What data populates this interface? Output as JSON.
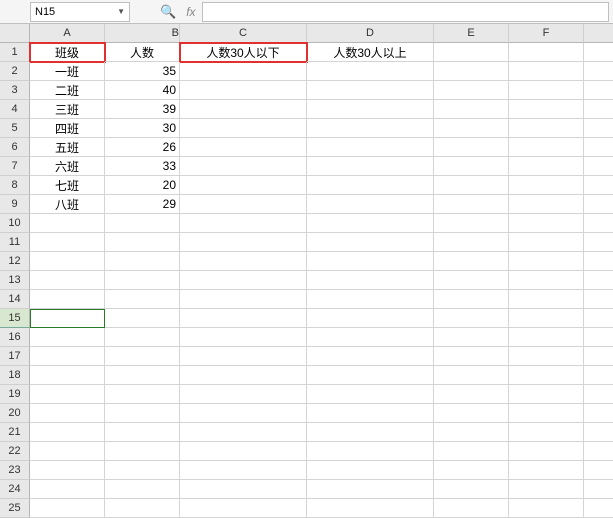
{
  "namebox": {
    "value": "N15"
  },
  "fx": {
    "label": "fx"
  },
  "columns": [
    "A",
    "B",
    "C",
    "D",
    "E",
    "F"
  ],
  "highlighted_headers": [
    "A",
    "C"
  ],
  "active_row": 15,
  "row_count": 25,
  "headers": {
    "A": "班级",
    "B": "人数",
    "C": "人数30人以下",
    "D": "人数30人以上"
  },
  "rows": [
    {
      "A": "一班",
      "B": "35"
    },
    {
      "A": "二班",
      "B": "40"
    },
    {
      "A": "三班",
      "B": "39"
    },
    {
      "A": "四班",
      "B": "30"
    },
    {
      "A": "五班",
      "B": "26"
    },
    {
      "A": "六班",
      "B": "33"
    },
    {
      "A": "七班",
      "B": "20"
    },
    {
      "A": "八班",
      "B": "29"
    }
  ]
}
